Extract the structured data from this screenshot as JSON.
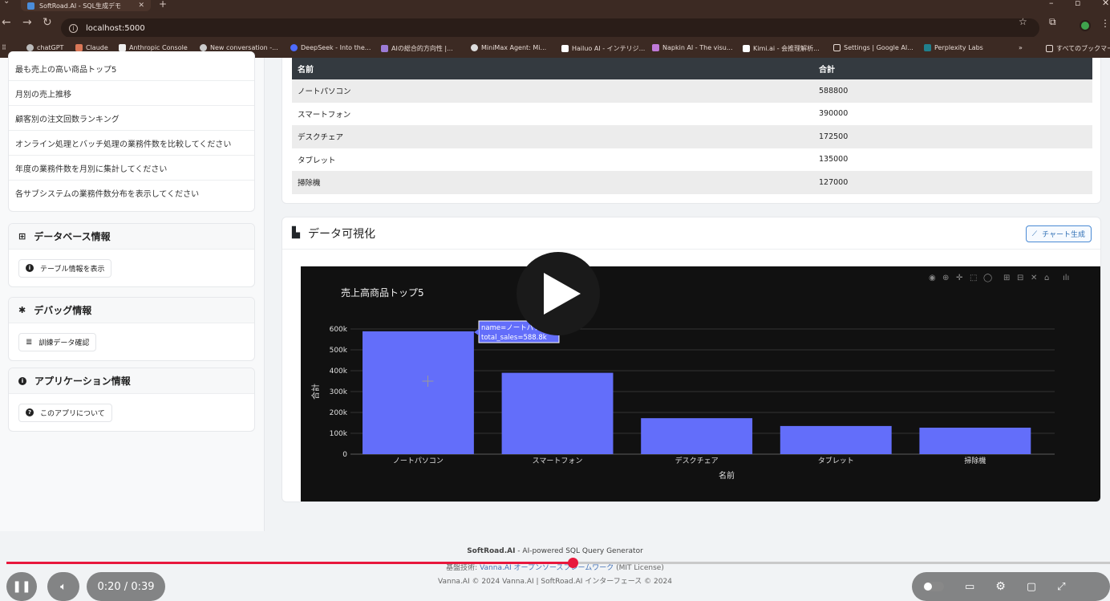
{
  "browser": {
    "tab_title": "SoftRoad.AI - SQL生成デモ",
    "url": "localhost:5000",
    "bookmarks": [
      "chatGPT",
      "Claude",
      "Anthropic Console",
      "New conversation -...",
      "DeepSeek - Into the...",
      "AIの総合的方向性 |...",
      "MiniMax Agent: Mi...",
      "Hailuo AI - インテリジ...",
      "Napkin AI - The visu...",
      "Kimi.ai - 会推理解析...",
      "Settings | Google AI...",
      "Perplexity Labs"
    ],
    "all_bookmarks": "すべてのブックマーク"
  },
  "sidebar": {
    "questions": [
      "最も売上の高い商品トップ5",
      "月別の売上推移",
      "顧客別の注文回数ランキング",
      "オンライン処理とバッチ処理の業務件数を比較してください",
      "年度の業務件数を月別に集計してください",
      "各サブシステムの業務件数分布を表示してください"
    ],
    "db_title": "データベース情報",
    "db_button": "テーブル情報を表示",
    "debug_title": "デバッグ情報",
    "debug_button": "訓練データ確認",
    "app_title": "アプリケーション情報",
    "app_button": "このアプリについて"
  },
  "table": {
    "headers": [
      "名前",
      "合計"
    ],
    "rows": [
      [
        "ノートパソコン",
        "588800"
      ],
      [
        "スマートフォン",
        "390000"
      ],
      [
        "デスクチェア",
        "172500"
      ],
      [
        "タブレット",
        "135000"
      ],
      [
        "掃除機",
        "127000"
      ]
    ]
  },
  "viz": {
    "title": "データ可視化",
    "button": "チャート生成"
  },
  "chart_data": {
    "type": "bar",
    "title": "売上高商品トップ5",
    "xlabel": "名前",
    "ylabel": "合計",
    "categories": [
      "ノートパソコン",
      "スマートフォン",
      "デスクチェア",
      "タブレット",
      "掃除機"
    ],
    "values": [
      588800,
      390000,
      172500,
      135000,
      127000
    ],
    "yticks": [
      "0",
      "100k",
      "200k",
      "300k",
      "400k",
      "500k",
      "600k"
    ],
    "ylim": [
      0,
      600000
    ],
    "bar_color": "#636efa",
    "tooltip": {
      "line1": "name=ノートパソコン",
      "line2": "total_sales=588.8k"
    }
  },
  "footer": {
    "brand": "SoftRoad.AI",
    "tagline": " - AI-powered SQL Query Generator",
    "tech_label": "基盤技術: ",
    "tech_link": "Vanna.AI オープンソースフレームワーク",
    "license": " (MIT License)",
    "copyright": "Vanna.AI © 2024 Vanna.AI | SoftRoad.AI インターフェース © 2024"
  },
  "video": {
    "time": "0:20 / 0:39",
    "progress": 0.513
  }
}
